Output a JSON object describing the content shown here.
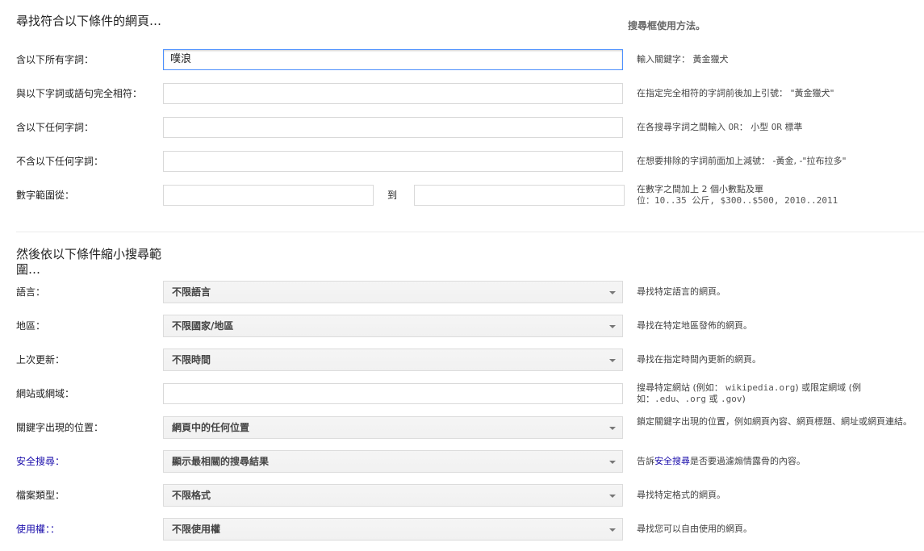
{
  "find_section": {
    "title": "尋找符合以下條件的網頁…",
    "help_title": "搜尋框使用方法。",
    "rows": [
      {
        "label": "含以下所有字詞：",
        "value": "噗浪",
        "help": "輸入關鍵字： 黃金獵犬"
      },
      {
        "label": "與以下字詞或語句完全相符：",
        "value": "",
        "help": "在指定完全相符的字詞前後加上引號： \"黃金獵犬\""
      },
      {
        "label": "含以下任何字詞：",
        "value": "",
        "help_pre": "在各搜尋字詞之間輸入 ",
        "help_or1": "OR",
        "help_mid": "： 小型 ",
        "help_or2": "OR",
        "help_post": " 標準"
      },
      {
        "label": "不含以下任何字詞：",
        "value": "",
        "help": "在想要排除的字詞前面加上減號： -黃金, -\"拉布拉多\""
      },
      {
        "label": "數字範圍從：",
        "to_label": "到",
        "help_line1": "在數字之間加上 2 個小數點及單",
        "help_line2": "位：10..35 公斤, $300..$500, 2010..2011"
      }
    ]
  },
  "narrow_section": {
    "title": "然後依以下條件縮小搜尋範圍…",
    "rows": [
      {
        "label": "語言：",
        "value": "不限語言",
        "help": "尋找特定語言的網頁。"
      },
      {
        "label": "地區：",
        "value": "不限國家/地區",
        "help": "尋找在特定地區發佈的網頁。"
      },
      {
        "label": "上次更新：",
        "value": "不限時間",
        "help": "尋找在指定時間內更新的網頁。"
      },
      {
        "label": "網站或網域：",
        "value": "",
        "help_line1_pre": "搜尋特定網站 (例如： ",
        "help_line1_code": "wikipedia.org",
        "help_line1_post": ") 或限定網域 (例",
        "help_line2_pre": "如：",
        "help_line2_code1": ".edu",
        "help_line2_sep": "、",
        "help_line2_code2": ".org",
        "help_line2_or": " 或 ",
        "help_line2_code3": ".gov",
        "help_line2_post": ")"
      },
      {
        "label": "關鍵字出現的位置：",
        "value": "網頁中的任何位置",
        "help": "鎖定關鍵字出現的位置，例如網頁內容、網頁標題、網址或網頁連結。"
      },
      {
        "label": "安全搜尋：",
        "value": "顯示最相關的搜尋結果",
        "help_pre": "告訴",
        "help_link": "安全搜尋",
        "help_post": "是否要過濾煽情露骨的內容。"
      },
      {
        "label": "檔案類型：",
        "value": "不限格式",
        "help": "尋找特定格式的網頁。"
      },
      {
        "label": "使用權：：",
        "value": "不限使用權",
        "help": "尋找您可以自由使用的網頁。"
      }
    ]
  },
  "colors": {
    "link": "#1a0dab",
    "focus_border": "#4d90fe"
  },
  "icons": {
    "select_arrow": "chevron-down-icon"
  }
}
